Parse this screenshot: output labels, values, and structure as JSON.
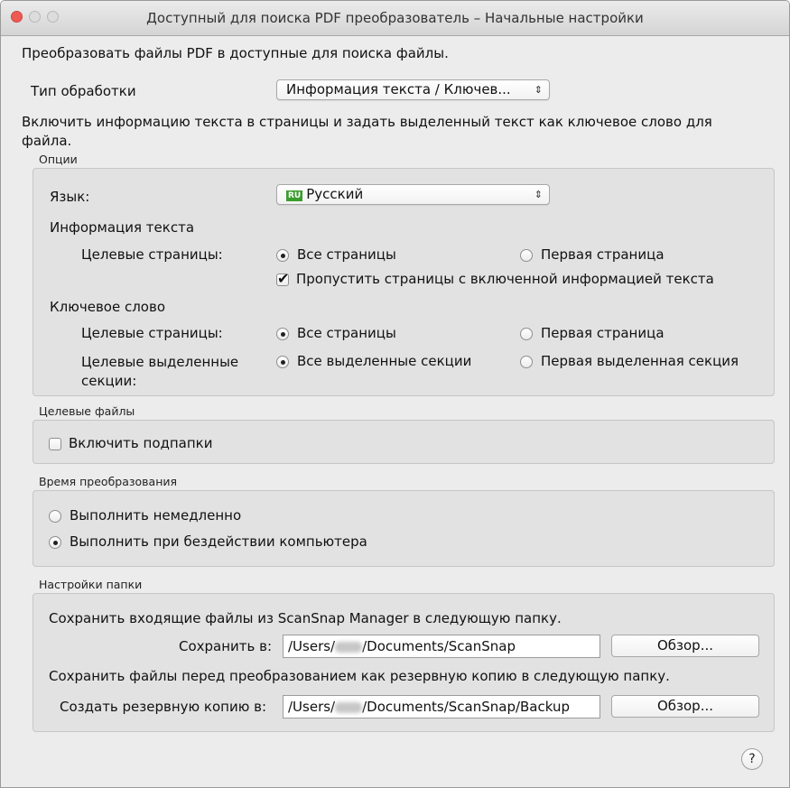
{
  "window": {
    "title": "Доступный для поиска PDF преобразователь – Начальные настройки"
  },
  "intro": "Преобразовать файлы PDF в доступные для поиска файлы.",
  "processing": {
    "label": "Тип обработки",
    "value": "Информация текста / Ключев...",
    "description": "Включить информацию текста в страницы и задать выделенный текст как ключевое слово для файла."
  },
  "options": {
    "group_label": "Опции",
    "language_label": "Язык:",
    "language_flag": "RU",
    "language_value": "Русский",
    "text_info": {
      "heading": "Информация текста",
      "target_pages_label": "Целевые страницы:",
      "all_pages": "Все страницы",
      "first_page": "Первая страница",
      "selected": "all_pages",
      "skip_label": "Пропустить страницы с включенной информацией текста",
      "skip_checked": true
    },
    "keyword": {
      "heading": "Ключевое слово",
      "target_pages_label": "Целевые страницы:",
      "all_pages": "Все страницы",
      "first_page": "Первая страница",
      "selected_pages": "all_pages",
      "sections_label_line1": "Целевые выделенные",
      "sections_label_line2": "секции:",
      "all_sections": "Все выделенные секции",
      "first_section": "Первая выделенная секция",
      "selected_sections": "all_sections"
    }
  },
  "target_files": {
    "group_label": "Целевые файлы",
    "subfolders_label": "Включить подпапки",
    "subfolders_checked": false
  },
  "conversion_time": {
    "group_label": "Время преобразования",
    "immediately": "Выполнить немедленно",
    "idle": "Выполнить при бездействии компьютера",
    "selected": "idle"
  },
  "folder_settings": {
    "group_label": "Настройки папки",
    "save_description": "Сохранить входящие файлы из ScanSnap Manager в следующую папку.",
    "save_label": "Сохранить в:",
    "save_path_prefix": "/Users/",
    "save_path_suffix": "/Documents/ScanSnap",
    "browse_label": "Обзор...",
    "backup_description": "Сохранить файлы перед преобразованием как резервную копию в следующую папку.",
    "backup_label": "Создать резервную копию в:",
    "backup_path_prefix": "/Users/",
    "backup_path_suffix": "/Documents/ScanSnap/Backup",
    "backup_browse_label": "Обзор..."
  },
  "help": {
    "label": "?"
  }
}
